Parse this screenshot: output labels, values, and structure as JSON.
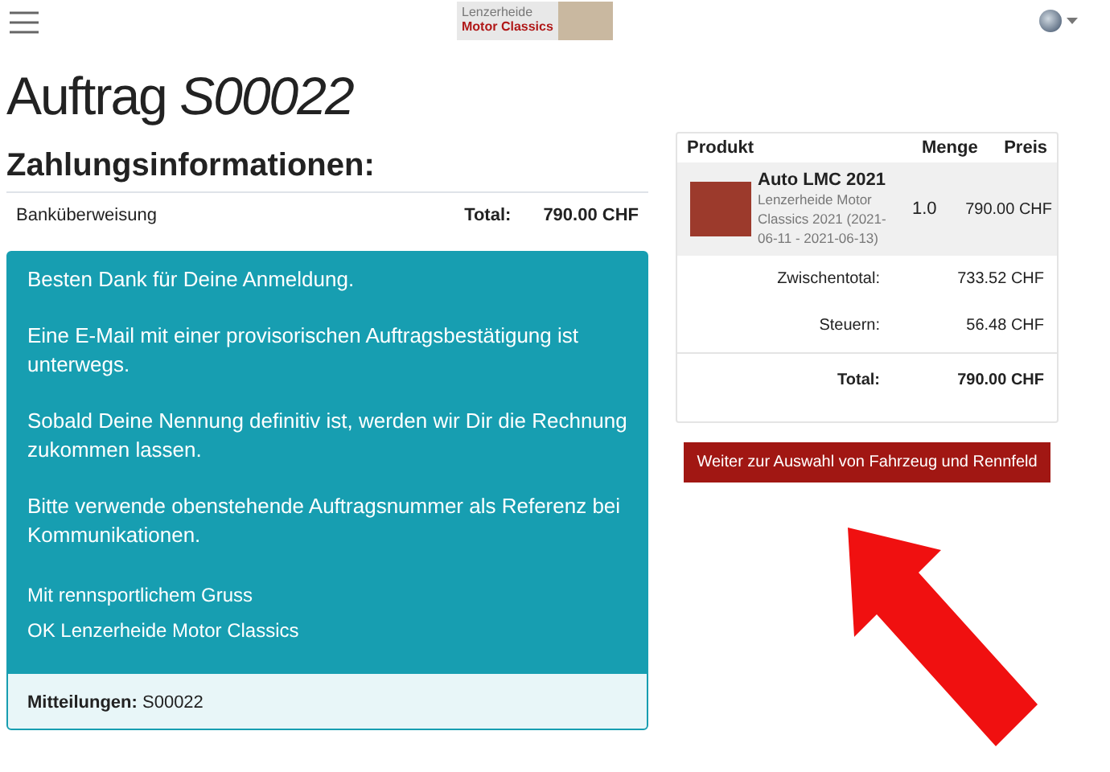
{
  "navbar": {
    "logo": {
      "line_1": "Lenzerheide",
      "line_2": "Motor Classics"
    }
  },
  "order": {
    "label": "Auftrag",
    "number": "S00022"
  },
  "payment": {
    "heading": "Zahlungsinformationen:",
    "method": "Banküberweisung",
    "total_label": "Total:",
    "total_value": "790.00 CHF"
  },
  "message": {
    "paragraphs": [
      "Besten Dank für Deine Anmeldung.",
      "Eine E-Mail mit einer provisorischen Auftragsbestätigung ist unterwegs.",
      "Sobald Deine Nennung definitiv ist, werden wir Dir die Rechnung zukommen lassen.",
      "Bitte verwende obenstehende Auftragsnummer als Referenz bei Kommunikationen."
    ],
    "closing": [
      "Mit rennsportlichem Gruss",
      "OK Lenzerheide Motor Classics"
    ],
    "footer": {
      "label": "Mitteilungen:",
      "value": "S00022"
    }
  },
  "cart": {
    "columns": [
      "Produkt",
      "Menge",
      "Preis"
    ],
    "items": [
      {
        "name": "Auto LMC 2021",
        "description": "Lenzerheide Motor Classics 2021 (2021-06-11 - 2021-06-13)",
        "quantity": "1.0",
        "price": "790.00 CHF"
      }
    ],
    "summary": [
      {
        "label": "Zwischentotal:",
        "value": "733.52 CHF",
        "kind": "normal"
      },
      {
        "label": "Steuern:",
        "value": "56.48 CHF",
        "kind": "normal"
      },
      {
        "label": "Total:",
        "value": "790.00 CHF",
        "kind": "total"
      }
    ]
  },
  "continue_button": "Weiter zur Auswahl von Fahrzeug und Rennfeld"
}
